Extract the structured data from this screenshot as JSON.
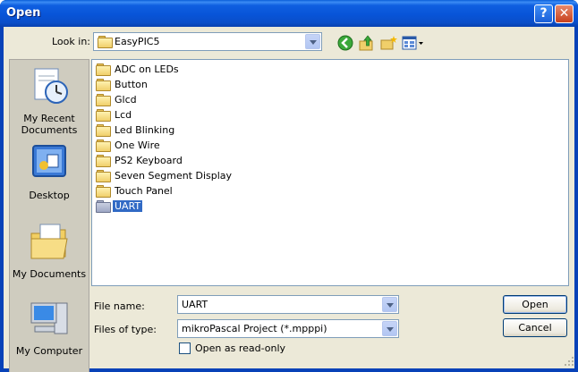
{
  "window": {
    "title": "Open"
  },
  "titlebar": {
    "help_label": "?",
    "close_label": "✕"
  },
  "toolbar": {
    "look_in_label": "Look in:",
    "look_in_value": "EasyPIC5"
  },
  "places": [
    {
      "label_line1": "My Recent",
      "label_line2": "Documents",
      "icon": "recent-documents-icon"
    },
    {
      "label_line1": "Desktop",
      "label_line2": "",
      "icon": "desktop-icon"
    },
    {
      "label_line1": "My Documents",
      "label_line2": "",
      "icon": "my-documents-icon"
    },
    {
      "label_line1": "My Computer",
      "label_line2": "",
      "icon": "my-computer-icon"
    }
  ],
  "files": [
    {
      "name": "ADC on LEDs"
    },
    {
      "name": "Button"
    },
    {
      "name": "Glcd"
    },
    {
      "name": "Lcd"
    },
    {
      "name": "Led Blinking"
    },
    {
      "name": "One Wire"
    },
    {
      "name": "PS2 Keyboard"
    },
    {
      "name": "Seven Segment Display"
    },
    {
      "name": "Touch Panel"
    },
    {
      "name": "UART"
    }
  ],
  "selected_index": 9,
  "form": {
    "file_name_label": "File name:",
    "file_name_value": "UART",
    "file_type_label": "Files of type:",
    "file_type_value": "mikroPascal Project (*.mpppi)",
    "readonly_label": "Open as read-only"
  },
  "buttons": {
    "open_label": "Open",
    "cancel_label": "Cancel"
  },
  "colors": {
    "title_blue": "#0a4ec8",
    "selection": "#316ac5",
    "dialog_bg": "#ece9d8"
  }
}
